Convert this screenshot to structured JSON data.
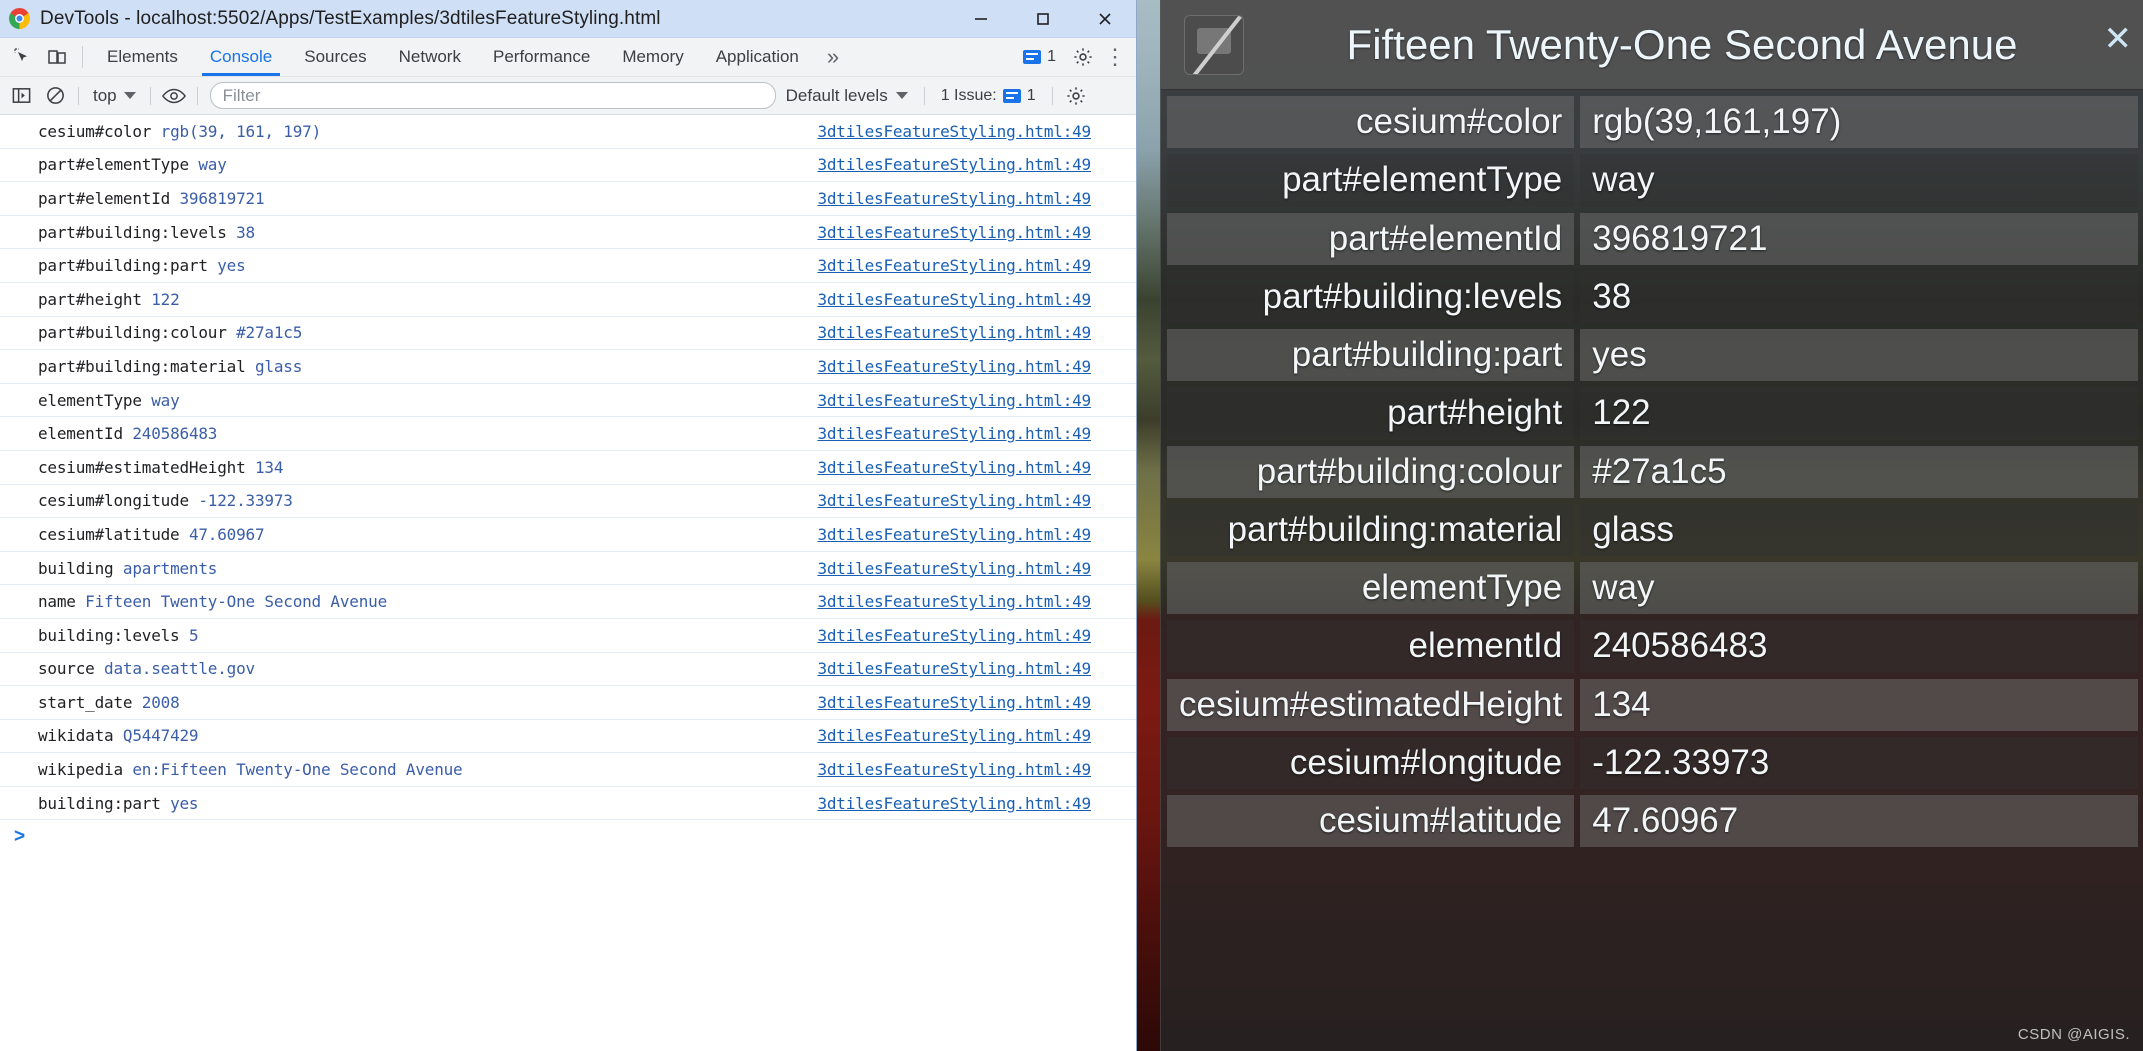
{
  "window": {
    "title": "DevTools - localhost:5502/Apps/TestExamples/3dtilesFeatureStyling.html",
    "minimize_label": "—",
    "maximize_label": "□",
    "close_label": "✕"
  },
  "tabs": [
    {
      "label": "Elements",
      "active": false
    },
    {
      "label": "Console",
      "active": true
    },
    {
      "label": "Sources",
      "active": false
    },
    {
      "label": "Network",
      "active": false
    },
    {
      "label": "Performance",
      "active": false
    },
    {
      "label": "Memory",
      "active": false
    },
    {
      "label": "Application",
      "active": false
    }
  ],
  "tabstrip": {
    "more_label": "»",
    "message_count": "1",
    "kebab_label": "⋮"
  },
  "console_toolbar": {
    "context_label": "top",
    "filter_placeholder": "Filter",
    "filter_value": "",
    "levels_label": "Default levels",
    "issues_label": "1 Issue:",
    "issues_count": "1"
  },
  "console": {
    "prompt": ">",
    "source_link": "3dtilesFeatureStyling.html:49",
    "entries": [
      {
        "key": "cesium#color",
        "value": "rgb(39, 161, 197)"
      },
      {
        "key": "part#elementType",
        "value": "way"
      },
      {
        "key": "part#elementId",
        "value": "396819721"
      },
      {
        "key": "part#building:levels",
        "value": "38"
      },
      {
        "key": "part#building:part",
        "value": "yes"
      },
      {
        "key": "part#height",
        "value": "122"
      },
      {
        "key": "part#building:colour",
        "value": "#27a1c5"
      },
      {
        "key": "part#building:material",
        "value": "glass"
      },
      {
        "key": "elementType",
        "value": "way"
      },
      {
        "key": "elementId",
        "value": "240586483"
      },
      {
        "key": "cesium#estimatedHeight",
        "value": "134"
      },
      {
        "key": "cesium#longitude",
        "value": "-122.33973"
      },
      {
        "key": "cesium#latitude",
        "value": "47.60967"
      },
      {
        "key": "building",
        "value": "apartments"
      },
      {
        "key": "name",
        "value": "Fifteen Twenty-One Second Avenue"
      },
      {
        "key": "building:levels",
        "value": "5"
      },
      {
        "key": "source",
        "value": "data.seattle.gov"
      },
      {
        "key": "start_date",
        "value": "2008"
      },
      {
        "key": "wikidata",
        "value": "Q5447429"
      },
      {
        "key": "wikipedia",
        "value": "en:Fifteen Twenty-One Second Avenue"
      },
      {
        "key": "building:part",
        "value": "yes"
      }
    ]
  },
  "infobox": {
    "title": "Fifteen Twenty-One Second Avenue",
    "close_label": "✕",
    "rows": [
      {
        "key": "cesium#color",
        "value": "rgb(39,161,197)"
      },
      {
        "key": "part#elementType",
        "value": "way"
      },
      {
        "key": "part#elementId",
        "value": "396819721"
      },
      {
        "key": "part#building:levels",
        "value": "38"
      },
      {
        "key": "part#building:part",
        "value": "yes"
      },
      {
        "key": "part#height",
        "value": "122"
      },
      {
        "key": "part#building:colour",
        "value": "#27a1c5"
      },
      {
        "key": "part#building:material",
        "value": "glass"
      },
      {
        "key": "elementType",
        "value": "way"
      },
      {
        "key": "elementId",
        "value": "240586483"
      },
      {
        "key": "cesium#estimatedHeight",
        "value": "134"
      },
      {
        "key": "cesium#longitude",
        "value": "-122.33973"
      },
      {
        "key": "cesium#latitude",
        "value": "47.60967"
      }
    ]
  },
  "watermark": "CSDN @AIGIS.",
  "colors": {
    "accent": "#1a73e8",
    "titlebar": "#cfdff5",
    "toolbar": "#f1f3f4",
    "log_value": "#3b5ea8",
    "link": "#1a5fb4",
    "infobox_bg": "#262626",
    "infobox_header": "#555555"
  }
}
